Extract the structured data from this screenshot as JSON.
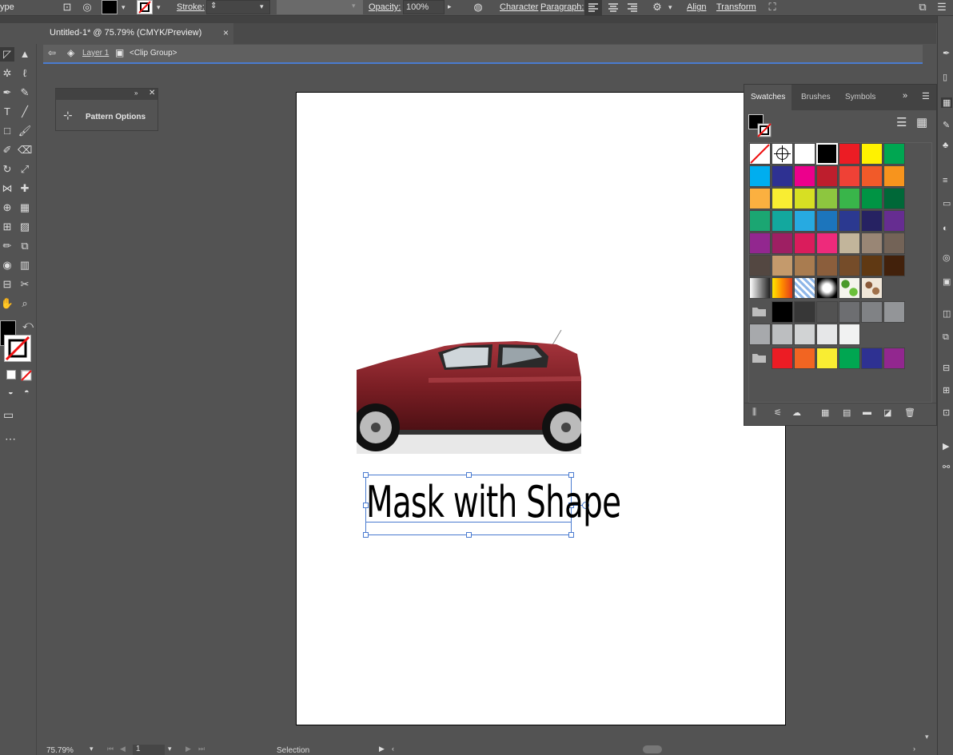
{
  "control_bar": {
    "mode_fragment": "ype",
    "stroke_label": "Stroke:",
    "opacity_label": "Opacity:",
    "opacity_value": "100%",
    "character_label": "Character",
    "paragraph_label": "Paragraph:",
    "align_label": "Align",
    "transform_label": "Transform"
  },
  "document": {
    "tab_title": "Untitled-1* @ 75.79% (CMYK/Preview)",
    "close_glyph": "×",
    "breadcrumb_layer": "Layer 1",
    "breadcrumb_group": "<Clip Group>"
  },
  "pattern_panel": {
    "label": "Pattern Options"
  },
  "artboard": {
    "text": "Mask with Shape",
    "car_color": "#7a1e24"
  },
  "swatches_panel": {
    "tabs": [
      "Swatches",
      "Brushes",
      "Symbols"
    ],
    "rows": [
      [
        "none",
        "registration",
        "#ffffff",
        "#000000",
        "#ec1c24",
        "#fff200",
        "#00a651"
      ],
      [
        "#00aeef",
        "#2e3192",
        "#ec008c",
        "#be1e2d",
        "#ef4136",
        "#f15a29",
        "#f7941d"
      ],
      [
        "#fbb040",
        "#f9ed32",
        "#d7df23",
        "#8dc63f",
        "#39b54a",
        "#009444",
        "#006838"
      ],
      [
        "#1ba672",
        "#13a89e",
        "#27aae1",
        "#1c75bc",
        "#2b3990",
        "#262262",
        "#662d91"
      ],
      [
        "#92278f",
        "#9e1f63",
        "#da1c5c",
        "#ee2a7b",
        "#c2b59b",
        "#998675",
        "#736357"
      ],
      [
        "#534741",
        "#c49a6c",
        "#a97c50",
        "#8b5e3c",
        "#754c29",
        "#603913",
        "#42210b"
      ],
      [
        "grad-gray",
        "grad-orange",
        "pattern-blue",
        "grad-radial",
        "pattern-leaf",
        "pattern-swirl",
        ""
      ],
      [
        "folder",
        "#000000",
        "#373737",
        "#525252",
        "#6d6e71",
        "#808285",
        "#939598"
      ],
      [
        "#a7a9ac",
        "#bcbec0",
        "#d1d3d4",
        "#e6e7e8",
        "#f1f2f2",
        "",
        ""
      ],
      [
        "folder",
        "#ec1c24",
        "#f26522",
        "#f9ed32",
        "#00a651",
        "#2e3192",
        "#92278f"
      ]
    ]
  },
  "status_bar": {
    "zoom": "75.79%",
    "artboard_number": "1",
    "tool": "Selection"
  },
  "colors": {
    "fill": "#000000",
    "selection_blue": "#4a7bd0"
  }
}
